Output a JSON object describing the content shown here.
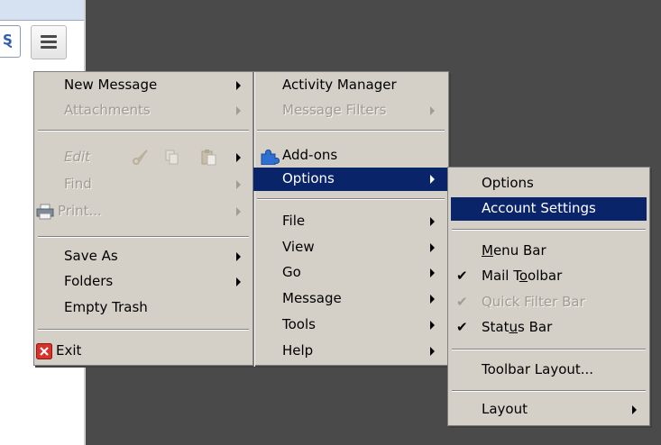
{
  "search": {
    "glyph": "Ȿ"
  },
  "menu_main": {
    "new_message": "New Message",
    "attachments": "Attachments",
    "edit": "Edit",
    "find": "Find",
    "print": "Print...",
    "save_as": "Save As",
    "folders": "Folders",
    "empty_trash": "Empty Trash",
    "exit": "Exit"
  },
  "menu_second": {
    "activity_manager": "Activity Manager",
    "message_filters": "Message Filters",
    "addons": "Add-ons",
    "options": "Options",
    "file": "File",
    "view": "View",
    "go": "Go",
    "message": "Message",
    "tools": "Tools",
    "help": "Help"
  },
  "menu_options": {
    "options": "Options",
    "account_settings": "Account Settings",
    "menu_bar_pre": "",
    "menu_bar_key": "M",
    "menu_bar_post": "enu Bar",
    "mail_toolbar_pre": "Mail T",
    "mail_toolbar_key": "o",
    "mail_toolbar_post": "olbar",
    "quick_filter_bar": "Quick Filter Bar",
    "status_bar_pre": "Stat",
    "status_bar_key": "u",
    "status_bar_post": "s Bar",
    "toolbar_layout": "Toolbar Layout...",
    "layout": "Layout",
    "checks": {
      "mail_toolbar": true,
      "quick_filter_bar": true,
      "status_bar": true
    }
  },
  "colors": {
    "menu_bg": "#d4d0c8",
    "highlight": "#0a246a",
    "desktop": "#4a4a4a"
  }
}
